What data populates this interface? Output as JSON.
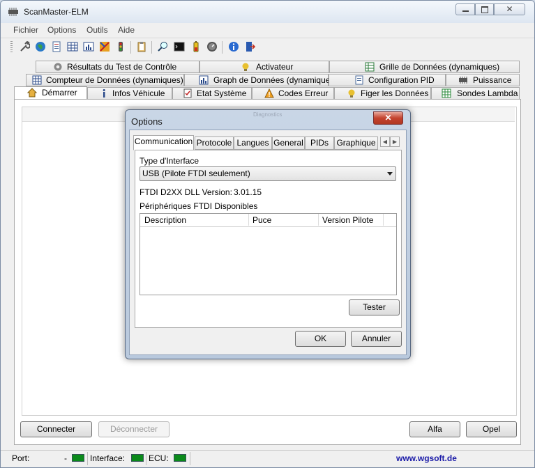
{
  "window": {
    "title": "ScanMaster-ELM"
  },
  "menu": [
    "Fichier",
    "Options",
    "Outils",
    "Aide"
  ],
  "toolbar_icons": [
    "wrench-icon",
    "globe-icon",
    "page-icon",
    "grid-icon",
    "graph-icon",
    "settings-icon",
    "traffic-light-icon",
    "clipboard-icon",
    "search-icon",
    "terminal-icon",
    "battery-icon",
    "gauge-icon",
    "info-icon",
    "exit-icon"
  ],
  "tabs": {
    "row1": [
      {
        "label": "Résultats du Test de Contrôle",
        "icon": "gear-icon"
      },
      {
        "label": "Activateur",
        "icon": "lightbulb-icon"
      },
      {
        "label": "Grille de Données (dynamiques)",
        "icon": "grid-icon"
      }
    ],
    "row2": [
      {
        "label": "Compteur de Données (dynamiques)",
        "icon": "grid-icon"
      },
      {
        "label": "Graph de Données (dynamiques)",
        "icon": "graph-icon"
      },
      {
        "label": "Configuration PID",
        "icon": "page-icon"
      },
      {
        "label": "Puissance",
        "icon": "chip-icon"
      }
    ],
    "row3": [
      {
        "label": "Démarrer",
        "icon": "home-icon"
      },
      {
        "label": "Infos Véhicule",
        "icon": "info-icon"
      },
      {
        "label": "Etat Système",
        "icon": "checklist-icon"
      },
      {
        "label": "Codes Erreur",
        "icon": "warning-icon"
      },
      {
        "label": "Figer les Données",
        "icon": "lightbulb-icon"
      },
      {
        "label": "Sondes Lambda",
        "icon": "sensor-icon"
      }
    ]
  },
  "buttons": {
    "connect": "Connecter",
    "disconnect": "Déconnecter",
    "alfa": "Alfa",
    "opel": "Opel"
  },
  "statusbar": {
    "port_label": "Port:",
    "port_value": "-",
    "interface_label": "Interface:",
    "ecu_label": "ECU:",
    "link": "www.wgsoft.de",
    "led_color": "#0a8a1a"
  },
  "dialog": {
    "title": "Options",
    "faded_title": "Diagnostics",
    "tabs": [
      "Communication",
      "Protocole",
      "Langues",
      "General",
      "PIDs",
      "Graphique"
    ],
    "interface_type_label": "Type d'Interface",
    "interface_type_value": "USB (Pilote FTDI seulement)",
    "dll_version_label": "FTDI D2XX DLL Version:",
    "dll_version_value": "3.01.15",
    "devices_label": "Périphériques FTDI Disponibles",
    "columns": [
      "Description",
      "Puce",
      "Version Pilote"
    ],
    "test_button": "Tester",
    "ok_button": "OK",
    "cancel_button": "Annuler"
  }
}
